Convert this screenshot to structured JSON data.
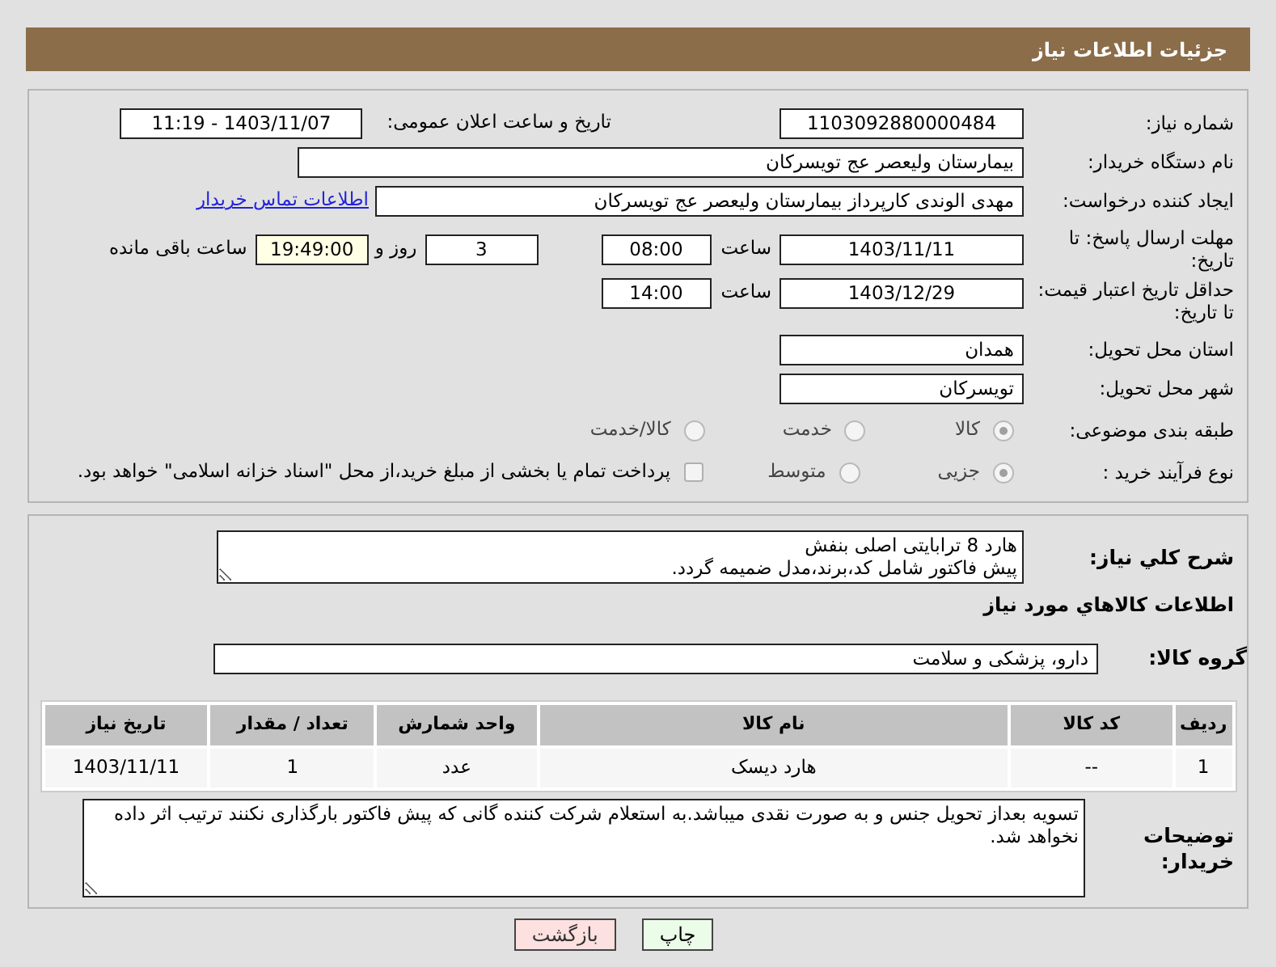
{
  "header": {
    "title": "جزئیات اطلاعات نیاز"
  },
  "need_number": {
    "label": "شماره نیاز:",
    "value": "1103092880000484"
  },
  "announce": {
    "label": "تاریخ و ساعت اعلان عمومی:",
    "value": "1403/11/07 - 11:19"
  },
  "buyer_org": {
    "label": "نام دستگاه خریدار:",
    "value": "بیمارستان ولیعصر  عج  تویسرکان"
  },
  "requester": {
    "label": "ایجاد کننده درخواست:",
    "value": "مهدی الوندی کارپرداز بیمارستان ولیعصر  عج  تویسرکان",
    "link": "اطلاعات تماس خریدار"
  },
  "response_deadline": {
    "label": "مهلت ارسال پاسخ: تا تاریخ:",
    "date": "1403/11/11",
    "time_label": "ساعت",
    "time": "08:00",
    "days": "3",
    "days_label": "روز و",
    "remaining": "19:49:00",
    "remaining_label": "ساعت باقی مانده"
  },
  "price_validity": {
    "label": "حداقل تاریخ اعتبار قیمت: تا تاریخ:",
    "date": "1403/12/29",
    "time_label": "ساعت",
    "time": "14:00"
  },
  "province": {
    "label": "استان محل تحویل:",
    "value": "همدان"
  },
  "city": {
    "label": "شهر محل تحویل:",
    "value": "تویسرکان"
  },
  "category": {
    "label": "طبقه بندی موضوعی:",
    "options": [
      {
        "label": "کالا",
        "selected": true
      },
      {
        "label": "خدمت",
        "selected": false
      },
      {
        "label": "کالا/خدمت",
        "selected": false
      }
    ]
  },
  "process": {
    "label": "نوع فرآیند خرید :",
    "options": [
      {
        "label": "جزیی",
        "selected": true
      },
      {
        "label": "متوسط",
        "selected": false
      }
    ],
    "payment": {
      "checked": false,
      "text": "پرداخت تمام یا بخشی از مبلغ خرید،از محل \"اسناد خزانه اسلامی\" خواهد بود."
    }
  },
  "description": {
    "label": "شرح کلي نیاز:",
    "lines": [
      "هارد 8 ترابایتی اصلی بنفش",
      "پیش فاکتور شامل کد،برند،مدل ضمیمه گردد."
    ]
  },
  "goods_heading": "اطلاعات کالاهاي مورد نیاز",
  "goods_group": {
    "label": "گروه کالا:",
    "value": "دارو، پزشکی و سلامت"
  },
  "table": {
    "columns": [
      "ردیف",
      "کد کالا",
      "نام کالا",
      "واحد شمارش",
      "تعداد / مقدار",
      "تاریخ نیاز"
    ],
    "rows": [
      [
        "1",
        "--",
        "هارد دیسک",
        "عدد",
        "1",
        "1403/11/11"
      ]
    ]
  },
  "buyer_notes": {
    "label": "توضیحات خریدار:",
    "value": "تسویه بعداز تحویل جنس و به صورت نقدی میباشد.به استعلام شرکت کننده گانی که پیش فاکتور بارگذاری نکنند ترتیب اثر داده نخواهد شد."
  },
  "buttons": [
    {
      "label": "چاپ",
      "kind": "print"
    },
    {
      "label": "بازگشت",
      "kind": "back"
    }
  ]
}
